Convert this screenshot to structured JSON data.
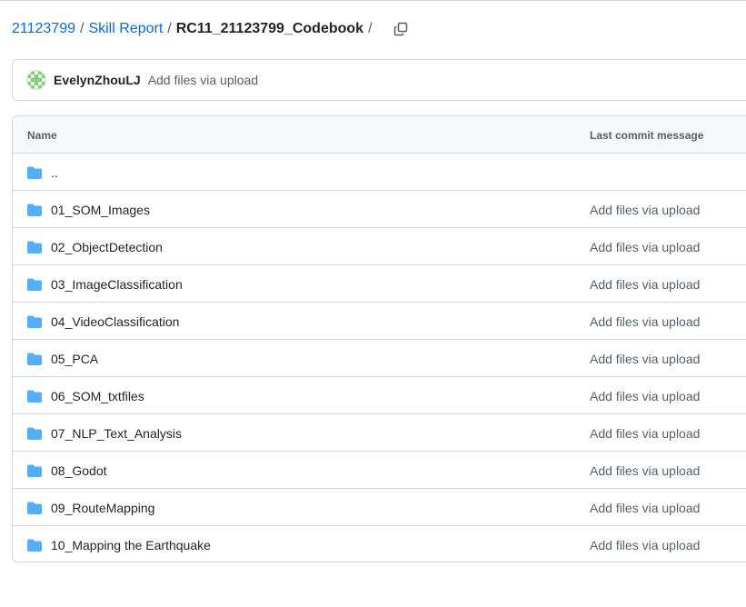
{
  "breadcrumb": {
    "owner": "21123799",
    "folder": "Skill Report",
    "current": "RC11_21123799_Codebook",
    "separator": "/"
  },
  "commit": {
    "author": "EvelynZhouLJ",
    "message": "Add files via upload"
  },
  "table": {
    "col_name": "Name",
    "col_message": "Last commit message",
    "rows": [
      {
        "name": "..",
        "message": ""
      },
      {
        "name": "01_SOM_Images",
        "message": "Add files via upload"
      },
      {
        "name": "02_ObjectDetection",
        "message": "Add files via upload"
      },
      {
        "name": "03_ImageClassification",
        "message": "Add files via upload"
      },
      {
        "name": "04_VideoClassification",
        "message": "Add files via upload"
      },
      {
        "name": "05_PCA",
        "message": "Add files via upload"
      },
      {
        "name": "06_SOM_txtfiles",
        "message": "Add files via upload"
      },
      {
        "name": "07_NLP_Text_Analysis",
        "message": "Add files via upload"
      },
      {
        "name": "08_Godot",
        "message": "Add files via upload"
      },
      {
        "name": "09_RouteMapping",
        "message": "Add files via upload"
      },
      {
        "name": "10_Mapping the Earthquake",
        "message": "Add files via upload"
      }
    ]
  },
  "colors": {
    "link": "#0969da",
    "folder": "#54aeff",
    "border": "#d0d7de"
  },
  "icons": {
    "copy": "copy-icon",
    "folder": "folder-icon",
    "avatar": "identicon-avatar"
  }
}
